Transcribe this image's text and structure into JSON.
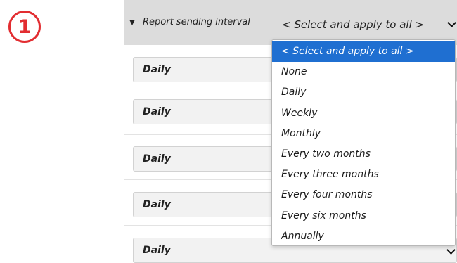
{
  "step_number": "1",
  "header": {
    "label": "Report sending interval",
    "apply_all_value": "< Select and apply to all >"
  },
  "rows": [
    {
      "value": "Daily"
    },
    {
      "value": "Daily"
    },
    {
      "value": "Daily"
    },
    {
      "value": "Daily"
    },
    {
      "value": "Daily"
    }
  ],
  "dropdown": {
    "selected_index": 0,
    "options": [
      "< Select and apply to all >",
      "None",
      "Daily",
      "Weekly",
      "Monthly",
      "Every two months",
      "Every three months",
      "Every four months",
      "Every six months",
      "Annually"
    ]
  },
  "colors": {
    "badge": "#e22d31",
    "selection": "#1f6fd1"
  }
}
